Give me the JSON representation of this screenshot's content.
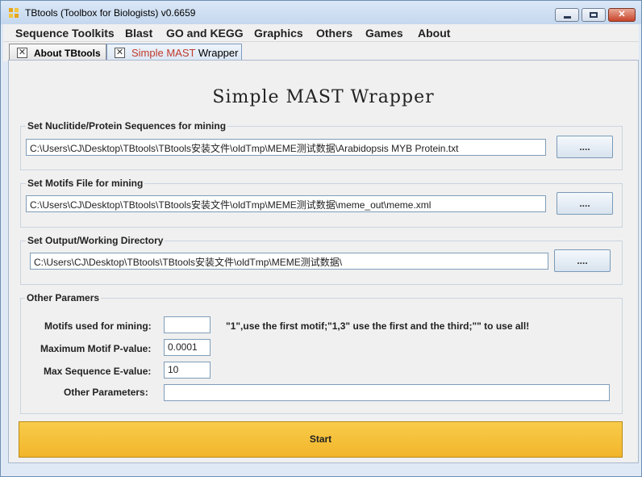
{
  "window": {
    "title": "TBtools (Toolbox for Biologists) v0.6659",
    "minimize": "",
    "maximize": "",
    "close": "✕"
  },
  "menu": [
    "Sequence Toolkits",
    "Blast",
    "GO and KEGG",
    "Graphics",
    "Others",
    "Games",
    "About"
  ],
  "tabs": {
    "tab1_label": "About TBtools",
    "tab2_highlight": "Simple MAST",
    "tab2_rest": " Wrapper",
    "close_glyph": "✕"
  },
  "heading": "Simple MAST Wrapper",
  "sequences": {
    "label": "Set Nuclitide/Protein Sequences for mining",
    "value": "C:\\Users\\CJ\\Desktop\\TBtools\\TBtools安装文件\\oldTmp\\MEME测试数据\\Arabidopsis MYB Protein.txt",
    "button": "...."
  },
  "motifs": {
    "label": "Set Motifs File for mining",
    "value": "C:\\Users\\CJ\\Desktop\\TBtools\\TBtools安装文件\\oldTmp\\MEME测试数据\\meme_out\\meme.xml",
    "button": "...."
  },
  "output": {
    "label": "Set Output/Working Directory",
    "value": "C:\\Users\\CJ\\Desktop\\TBtools\\TBtools安装文件\\oldTmp\\MEME测试数据\\",
    "button": "...."
  },
  "params": {
    "label": "Other  Paramers",
    "motifs_used_label": "Motifs used for mining:",
    "motifs_used_value": "",
    "motifs_hint": "\"1\",use the first motif;\"1,3\" use the first and the third;\"\" to use all!",
    "pvalue_label": "Maximum Motif P-value:",
    "pvalue_value": "0.0001",
    "evalue_label": "Max Sequence E-value:",
    "evalue_value": "10",
    "other_label": "Other Parameters:",
    "other_value": ""
  },
  "start_label": "Start",
  "colors": {
    "start_button": "#f2b52b",
    "tab_highlight": "#c0392b"
  }
}
